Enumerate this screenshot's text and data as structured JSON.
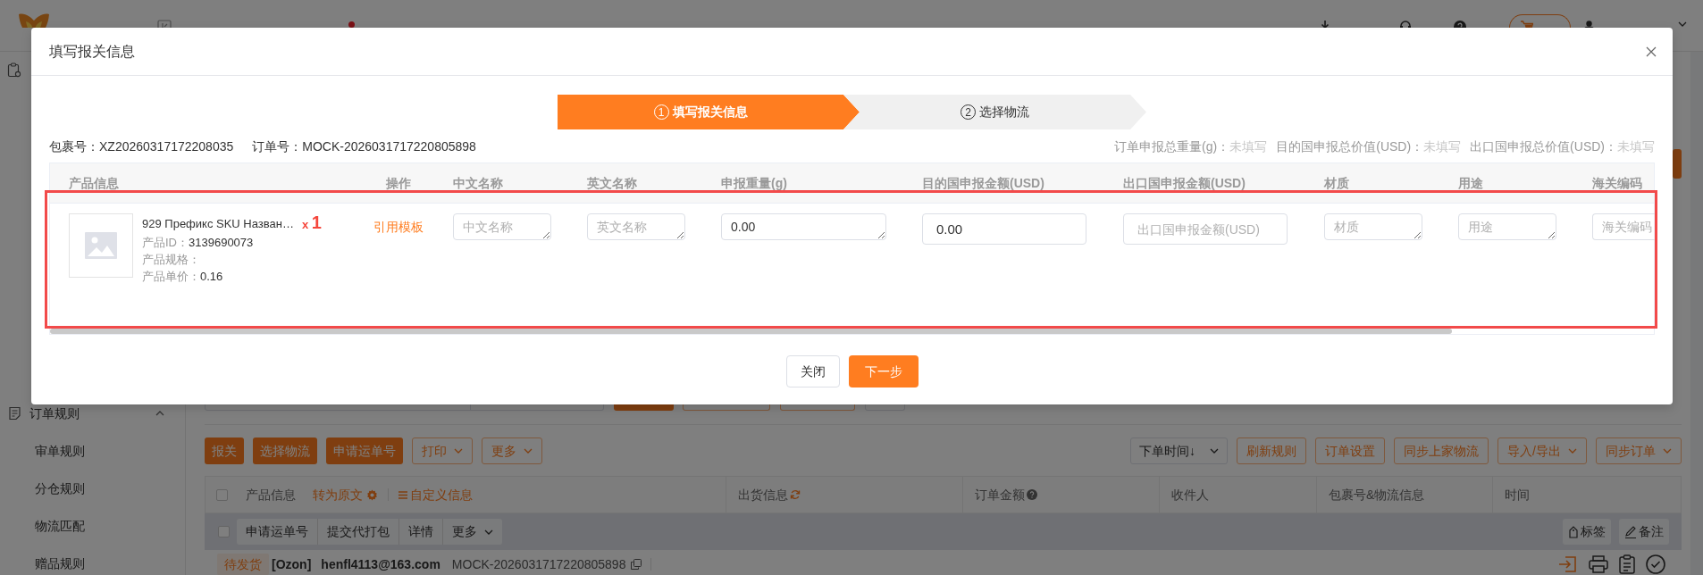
{
  "sidebar": {
    "items": [
      {
        "label": "订单规则",
        "expanded": true,
        "children": [
          {
            "label": "审单规则"
          },
          {
            "label": "分仓规则"
          },
          {
            "label": "物流匹配"
          },
          {
            "label": "赠品规则"
          }
        ]
      }
    ]
  },
  "toolbar": {
    "left_buttons": [
      {
        "label": "报关",
        "kind": "primary"
      },
      {
        "label": "选择物流",
        "kind": "primary"
      },
      {
        "label": "申请运单号",
        "kind": "primary"
      },
      {
        "label": "打印",
        "kind": "dropdown"
      },
      {
        "label": "更多",
        "kind": "dropdown"
      }
    ],
    "sort": "下单时间↓",
    "right_buttons": [
      {
        "label": "刷新规则",
        "kind": "outline"
      },
      {
        "label": "订单设置",
        "kind": "outline"
      },
      {
        "label": "同步上家物流",
        "kind": "outline"
      },
      {
        "label": "导入/导出",
        "kind": "dropdown"
      },
      {
        "label": "同步订单",
        "kind": "dropdown"
      }
    ]
  },
  "orders_table": {
    "header_checked": false,
    "product_column": "产品信息",
    "translate_link": "转为原文",
    "custom_link": "自定义信息",
    "columns": [
      {
        "label": "出货信息",
        "kind": "refresh"
      },
      {
        "label": "订单金额",
        "kind": "help"
      },
      {
        "label": "收件人",
        "kind": "plain"
      },
      {
        "label": "包裹号&物流信息",
        "kind": "plain"
      },
      {
        "label": "时间",
        "kind": "plain"
      }
    ],
    "group": {
      "checked": false,
      "buttons": [
        {
          "label": "申请运单号",
          "kind": "plain"
        },
        {
          "label": "提交代打包",
          "kind": "plain"
        },
        {
          "label": "详情",
          "kind": "plain"
        },
        {
          "label": "更多",
          "kind": "dropdown"
        }
      ],
      "tools": [
        {
          "label": "标签",
          "kind": "tag"
        },
        {
          "label": "备注",
          "kind": "note"
        }
      ]
    },
    "order": {
      "status": "待发货",
      "platform": "[Ozon]",
      "buyer": "henfl4113@163.com",
      "order_no": "MOCK-2026031717220805898"
    }
  },
  "dialog": {
    "title": "填写报关信息",
    "steps": [
      {
        "number": "1",
        "label": "填写报关信息",
        "selected": true
      },
      {
        "number": "2",
        "label": "选择物流",
        "selected": false
      }
    ],
    "package": {
      "label": "包裹号：",
      "value": "XZ20260317172208035"
    },
    "order": {
      "label": "订单号：",
      "value": "MOCK-2026031717220805898"
    },
    "totals": [
      {
        "label": "订单申报总重量(g)：",
        "value": "未填写"
      },
      {
        "label": "目的国申报总价值(USD)：",
        "value": "未填写"
      },
      {
        "label": "出口国申报总价值(USD)：",
        "value": "未填写"
      }
    ],
    "table": {
      "columns": [
        "产品信息",
        "操作",
        "中文名称",
        "英文名称",
        "申报重量(g)",
        "目的国申报金额(USD)",
        "出口国申报金额(USD)",
        "材质",
        "用途",
        "海关编码"
      ],
      "rows": [
        {
          "name": "929 Префикс SKU Назван…",
          "quantity": {
            "prefix": "x",
            "value": "1"
          },
          "details": [
            {
              "label": "产品ID：",
              "value": "3139690073"
            },
            {
              "label": "产品规格："
            },
            {
              "label": "产品单价：",
              "value": "0.16"
            }
          ],
          "action": "引用模板",
          "fields": [
            {
              "kind": "textarea",
              "placeholder": "中文名称"
            },
            {
              "kind": "textarea",
              "placeholder": "英文名称"
            },
            {
              "kind": "textarea",
              "value": "0.00"
            },
            {
              "kind": "input",
              "value": "0.00"
            },
            {
              "kind": "input",
              "placeholder": "出口国申报金额(USD)"
            },
            {
              "kind": "textarea",
              "placeholder": "材质"
            },
            {
              "kind": "textarea",
              "placeholder": "用途"
            },
            {
              "kind": "textarea",
              "placeholder": "海关编码"
            }
          ]
        }
      ]
    },
    "buttons": [
      {
        "label": "关闭",
        "kind": "secondary"
      },
      {
        "label": "下一步",
        "kind": "primary"
      }
    ]
  }
}
